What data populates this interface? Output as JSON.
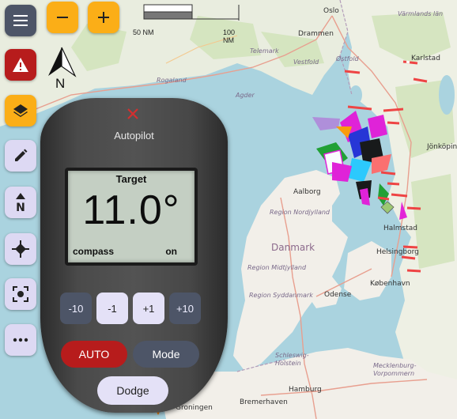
{
  "map": {
    "labels": {
      "oslo": "Oslo",
      "drammen": "Drammen",
      "ostfold": "Østfold",
      "telemark": "Telemark",
      "vestfold": "Vestfold",
      "rogaland": "Rogaland",
      "agder": "Agder",
      "varmlands_lan": "Värmlands län",
      "karlstad": "Karlstad",
      "jonkoping": "Jönköping",
      "aalborg": "Aalborg",
      "region_nordjylland": "Region Nordjylland",
      "danmark": "Danmark",
      "region_midtjylland": "Region Midtjylland",
      "region_syddanmark": "Region Syddanmark",
      "odense": "Odense",
      "helsingborg": "Helsingborg",
      "halmstad": "Halmstad",
      "kobenhavn": "København",
      "schleswig_holstein": "Schleswig-\nHolstein",
      "mecklenburg": "Mecklenburg-\nVorpommern",
      "hamburg": "Hamburg",
      "groningen": "Groningen",
      "bremerhaven": "Bremerhaven"
    },
    "scale": {
      "left": "50 NM",
      "right": "100 NM"
    },
    "north_label": "N"
  },
  "toolbar": {
    "menu_icon": "hamburger-menu-icon",
    "alarm_icon": "warning-triangle-icon",
    "layers_icon": "layers-icon",
    "edit_icon": "pencil-icon",
    "north_up_icon": "north-up-icon",
    "center_icon": "crosshair-icon",
    "focus_icon": "focus-vessel-icon",
    "more_icon": "more-dots-icon",
    "zoom_out": "−",
    "zoom_in": "+"
  },
  "autopilot": {
    "title": "Autopilot",
    "target_label": "Target",
    "target_value": "11.0°",
    "mode_label": "compass",
    "state_label": "on",
    "adjust": [
      "-10",
      "-1",
      "+1",
      "+10"
    ],
    "auto_label": "AUTO",
    "mode_button": "Mode",
    "dodge_button": "Dodge"
  },
  "colors": {
    "water": "#aad3df",
    "land": "#f2efe9",
    "forest": "#c8dcb0",
    "accent_orange": "#fbae17",
    "alarm_red": "#b71c1c",
    "side_button": "#ddd9f3"
  }
}
